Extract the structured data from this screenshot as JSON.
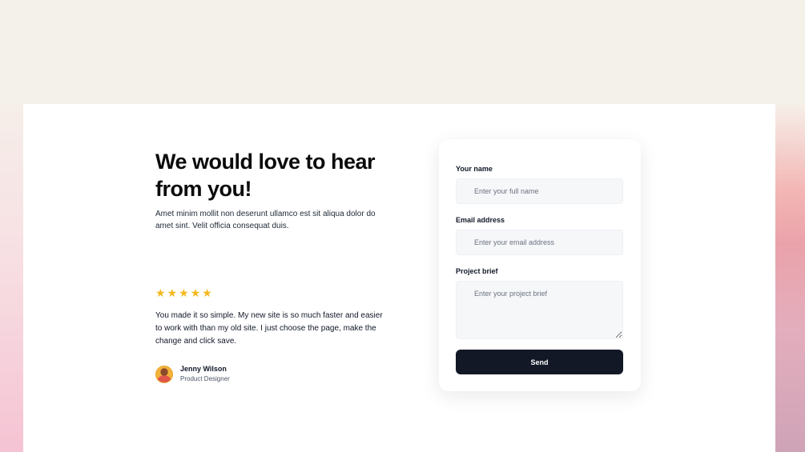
{
  "hero": {
    "title": "We would love to hear from you!",
    "description": "Amet minim mollit non deserunt ullamco est sit aliqua dolor do amet sint. Velit officia consequat duis."
  },
  "testimonial": {
    "rating": 5,
    "star": "★",
    "quote": "You made it so simple. My new site is so much faster and easier to work with than my old site. I just choose the page, make the change and click save.",
    "author_name": "Jenny Wilson",
    "author_role": "Product Designer"
  },
  "form": {
    "name_label": "Your name",
    "name_placeholder": "Enter your full name",
    "email_label": "Email address",
    "email_placeholder": "Enter your email address",
    "brief_label": "Project brief",
    "brief_placeholder": "Enter your project brief",
    "send_label": "Send"
  },
  "colors": {
    "page_bg": "#f4f1ea",
    "star": "#f5b81d",
    "button_bg": "#121826"
  }
}
